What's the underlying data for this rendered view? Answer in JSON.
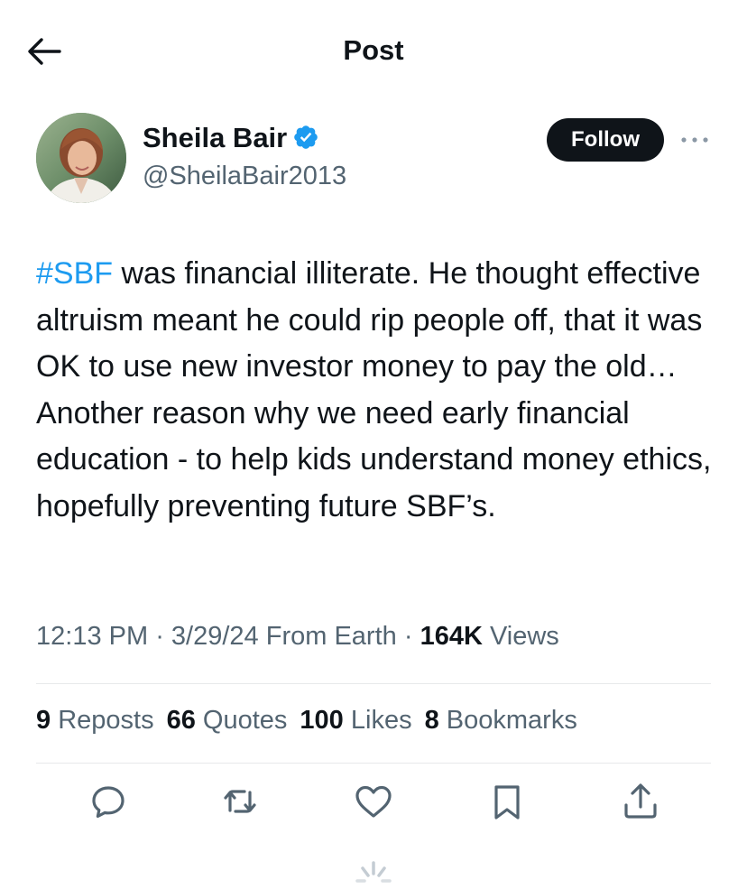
{
  "header": {
    "title": "Post",
    "back_icon": "arrow-left-icon"
  },
  "author": {
    "display_name": "Sheila Bair",
    "handle": "@SheilaBair2013",
    "verified": true,
    "verified_color": "#1d9bf0",
    "follow_label": "Follow",
    "more_icon": "more-horizontal-icon"
  },
  "post": {
    "hashtag": "#SBF",
    "text": " was financial illiterate. He thought effective altruism meant he could rip people off, that it was OK to use new investor money to pay the old… Another reason why we need early financial education - to help kids understand money ethics, hopefully preventing future SBF’s."
  },
  "meta": {
    "time": "12:13 PM",
    "separator1": " · ",
    "date": "3/29/24",
    "source": " From Earth",
    "separator2": " · ",
    "views_count": "164K",
    "views_label": " Views"
  },
  "stats": {
    "reposts_count": "9",
    "reposts_label": " Reposts",
    "quotes_count": "66",
    "quotes_label": " Quotes",
    "likes_count": "100",
    "likes_label": " Likes",
    "bookmarks_count": "8",
    "bookmarks_label": " Bookmarks"
  },
  "actions": [
    {
      "name": "reply",
      "icon": "reply-icon"
    },
    {
      "name": "repost",
      "icon": "repost-icon"
    },
    {
      "name": "like",
      "icon": "heart-icon"
    },
    {
      "name": "bookmark",
      "icon": "bookmark-icon"
    },
    {
      "name": "share",
      "icon": "share-icon"
    }
  ],
  "colors": {
    "text": "#0f1419",
    "secondary": "#536471",
    "link": "#1d9bf0",
    "divider": "#e7e9ea"
  }
}
